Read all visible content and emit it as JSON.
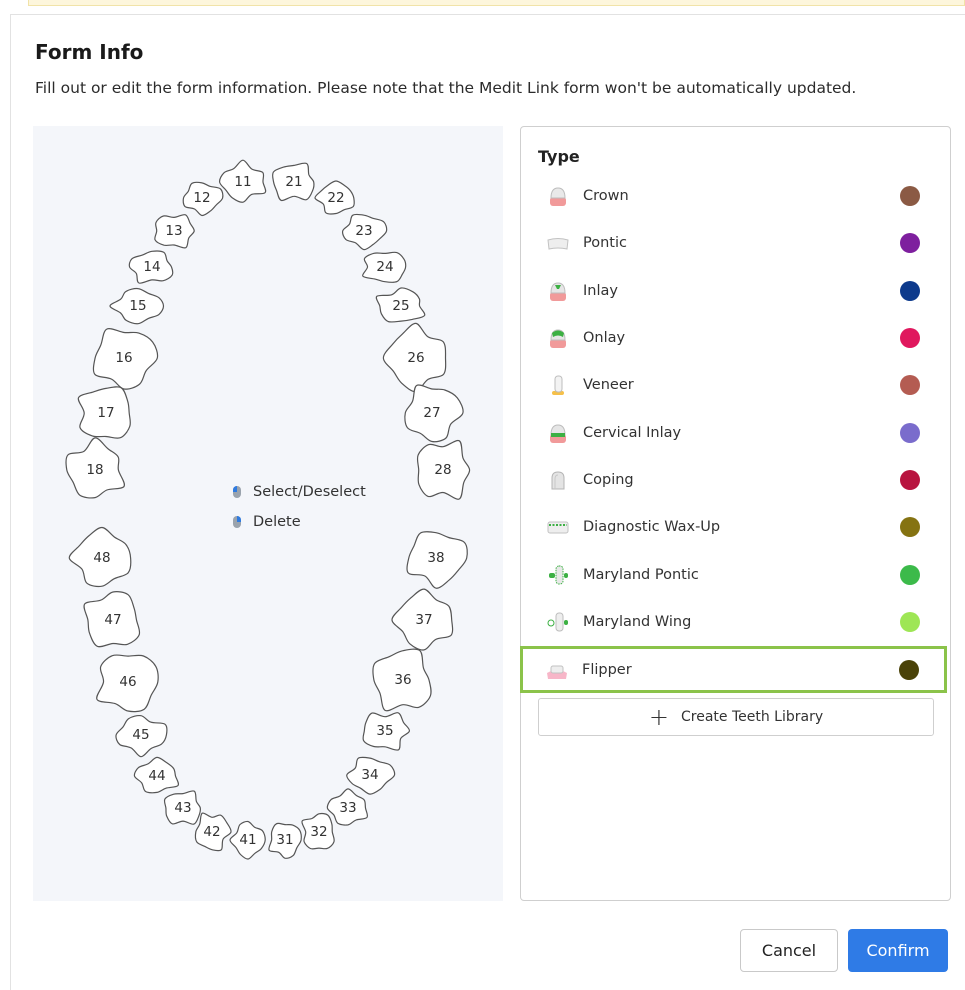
{
  "dialog": {
    "title": "Form Info",
    "subtitle": "Fill out or edit the form information. Please note that the Medit Link form won't be automatically updated."
  },
  "tooth_chart": {
    "teeth": [
      "11",
      "21",
      "12",
      "22",
      "13",
      "23",
      "14",
      "24",
      "15",
      "25",
      "16",
      "26",
      "17",
      "27",
      "18",
      "28",
      "48",
      "38",
      "47",
      "37",
      "46",
      "36",
      "45",
      "35",
      "44",
      "34",
      "43",
      "33",
      "42",
      "32",
      "41",
      "31"
    ],
    "legend": {
      "select_label": "Select/Deselect",
      "delete_label": "Delete"
    }
  },
  "type_panel": {
    "title": "Type",
    "items": [
      {
        "label": "Crown",
        "color": "#8b5a44",
        "icon": "crown-icon"
      },
      {
        "label": "Pontic",
        "color": "#7e1f9e",
        "icon": "pontic-icon"
      },
      {
        "label": "Inlay",
        "color": "#0d3a8c",
        "icon": "inlay-icon"
      },
      {
        "label": "Onlay",
        "color": "#e0185e",
        "icon": "onlay-icon"
      },
      {
        "label": "Veneer",
        "color": "#b45c52",
        "icon": "veneer-icon"
      },
      {
        "label": "Cervical Inlay",
        "color": "#7a6ccc",
        "icon": "cervical-inlay-icon"
      },
      {
        "label": "Coping",
        "color": "#b8143f",
        "icon": "coping-icon"
      },
      {
        "label": "Diagnostic Wax-Up",
        "color": "#857312",
        "icon": "diagnostic-wax-up-icon"
      },
      {
        "label": "Maryland Pontic",
        "color": "#3cba4a",
        "icon": "maryland-pontic-icon"
      },
      {
        "label": "Maryland Wing",
        "color": "#9ee655",
        "icon": "maryland-wing-icon"
      },
      {
        "label": "Flipper",
        "color": "#4a4208",
        "icon": "flipper-icon"
      }
    ],
    "selected": "Flipper",
    "create_label": "Create Teeth Library"
  },
  "footer": {
    "cancel_label": "Cancel",
    "confirm_label": "Confirm"
  }
}
